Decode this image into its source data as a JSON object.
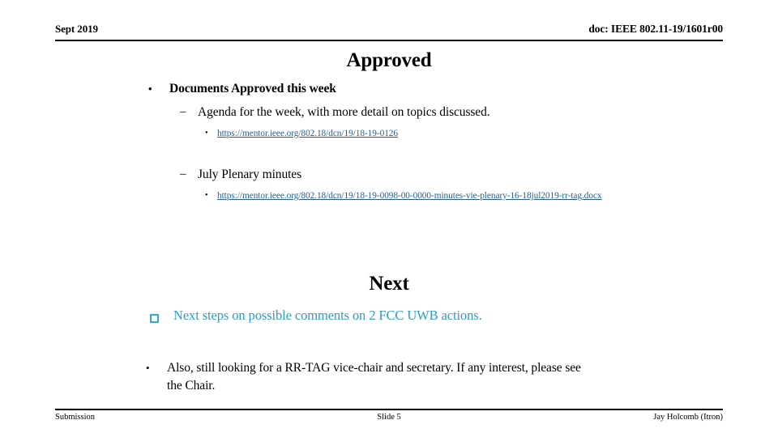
{
  "header": {
    "date": "Sept 2019",
    "doc": "doc: IEEE 802.11-19/1601r00"
  },
  "sections": {
    "approved": {
      "title": "Approved",
      "bullet_lvl1": "Documents Approved this week",
      "bullet_lvl1_marker": "•",
      "item1": {
        "marker": "–",
        "text": "Agenda for the week, with more detail on topics discussed.",
        "link_marker": "•",
        "link": "https://mentor.ieee.org/802.18/dcn/19/18-19-0126"
      },
      "item2": {
        "marker": "–",
        "text": "July Plenary minutes",
        "link_marker": "•",
        "link": "https://mentor.ieee.org/802.18/dcn/19/18-19-0098-00-0000-minutes-vie-plenary-16-18jul2019-rr-tag.docx"
      }
    },
    "next": {
      "title": "Next",
      "checkbox_item": "Next  steps on possible comments on 2 FCC UWB actions.",
      "checkbox_marker": "checkbox-square",
      "plain_item_marker": "•",
      "plain_item": "Also, still looking for a RR-TAG vice-chair and secretary.  If any interest, please see the Chair."
    }
  },
  "footer": {
    "left": "Submission",
    "center": "Slide 5",
    "right": "Jay Holcomb (Itron)"
  },
  "colors": {
    "link": "#1f5f95",
    "cyan_text": "#2e9cc4",
    "cyan_square": "#2eaad4",
    "text": "#000000",
    "background": "#ffffff"
  }
}
